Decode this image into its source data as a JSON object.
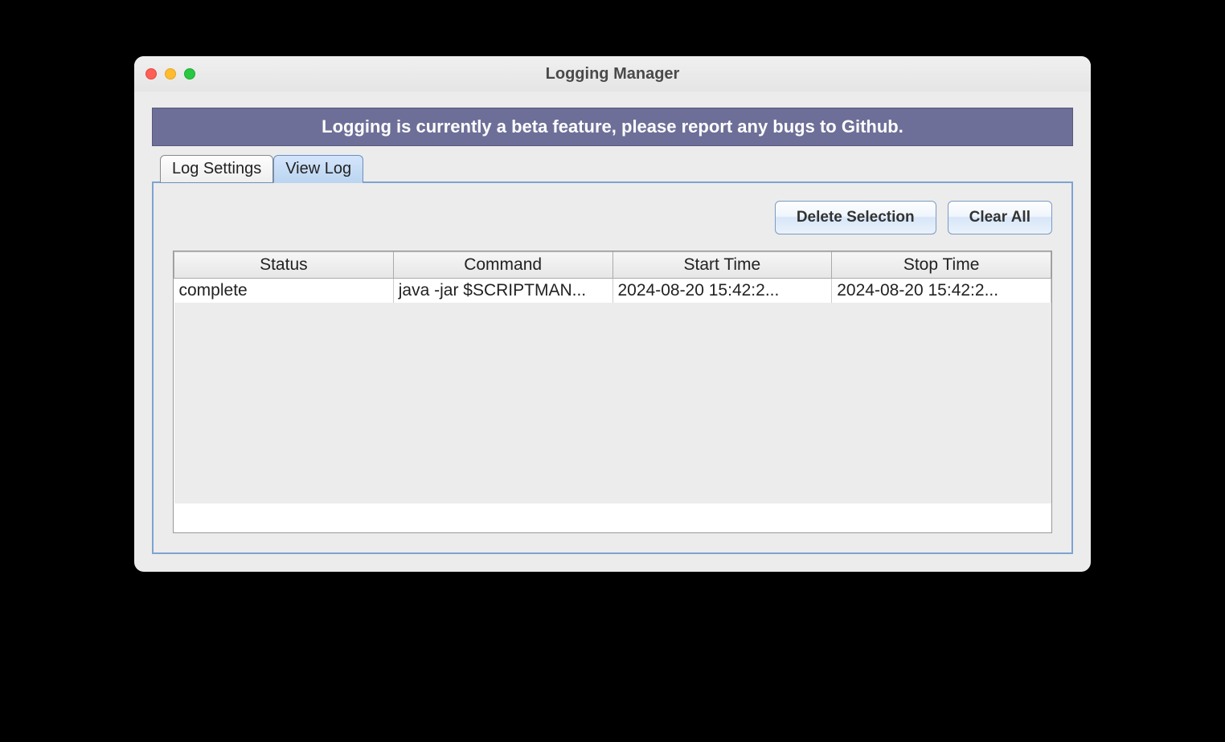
{
  "window": {
    "title": "Logging Manager"
  },
  "banner": {
    "text": "Logging is currently a beta feature, please report any bugs to Github."
  },
  "tabs": [
    {
      "label": "Log Settings",
      "active": false
    },
    {
      "label": "View Log",
      "active": true
    }
  ],
  "buttons": {
    "delete_selection": "Delete Selection",
    "clear_all": "Clear All"
  },
  "table": {
    "headers": [
      "Status",
      "Command",
      "Start Time",
      "Stop Time"
    ],
    "rows": [
      {
        "status": "complete",
        "command": "java -jar $SCRIPTMAN...",
        "start_time": "2024-08-20 15:42:2...",
        "stop_time": "2024-08-20 15:42:2..."
      }
    ]
  }
}
